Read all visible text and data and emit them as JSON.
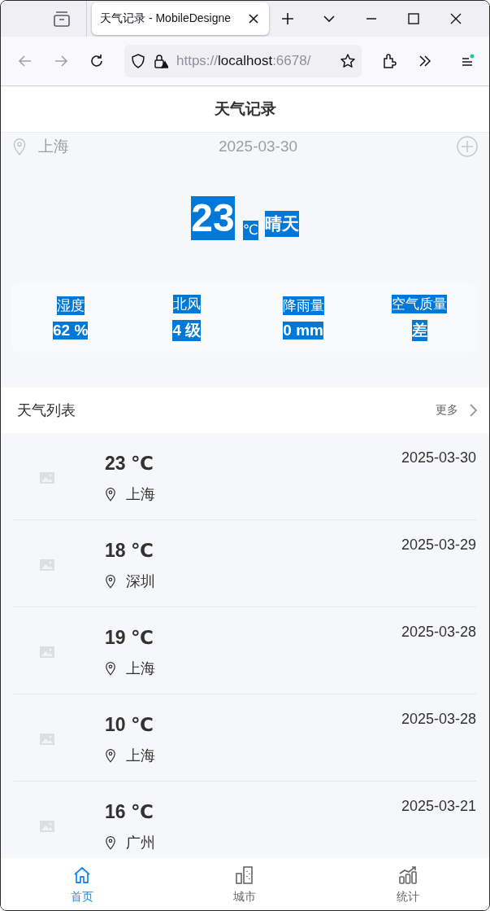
{
  "browser": {
    "tab_title": "天气记录 - MobileDesigne",
    "url_scheme": "https://",
    "url_host": "localhost",
    "url_rest": ":6678/"
  },
  "header": {
    "title": "天气记录"
  },
  "hero": {
    "city": "上海",
    "date": "2025-03-30",
    "temperature": "23",
    "unit": "℃",
    "condition": "晴天",
    "stats": [
      {
        "label": "湿度",
        "value": "62 %"
      },
      {
        "label": "北风",
        "value": "4 级"
      },
      {
        "label": "降雨量",
        "value": "0 mm"
      },
      {
        "label": "空气质量",
        "value": "差"
      }
    ]
  },
  "list": {
    "title": "天气列表",
    "more": "更多",
    "items": [
      {
        "temperature": "23 ℃",
        "city": "上海",
        "date": "2025-03-30"
      },
      {
        "temperature": "18 ℃",
        "city": "深圳",
        "date": "2025-03-29"
      },
      {
        "temperature": "19 ℃",
        "city": "上海",
        "date": "2025-03-28"
      },
      {
        "temperature": "10 ℃",
        "city": "上海",
        "date": "2025-03-28"
      },
      {
        "temperature": "16 ℃",
        "city": "广州",
        "date": "2025-03-21"
      }
    ]
  },
  "tabbar": [
    {
      "kind": "home",
      "label": "首页",
      "selected": true
    },
    {
      "kind": "city",
      "label": "城市",
      "selected": false
    },
    {
      "kind": "stats",
      "label": "统计",
      "selected": false
    }
  ]
}
